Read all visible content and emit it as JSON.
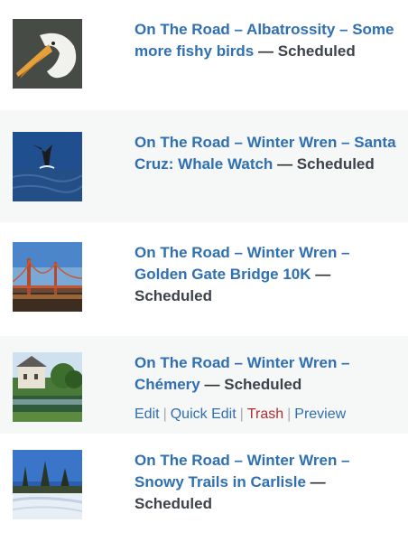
{
  "posts": [
    {
      "title": "On The Road – Albatrossity – Some more fishy birds",
      "separator": "—",
      "state": "Scheduled",
      "thumb_icon": "pelican-photo"
    },
    {
      "title": "On The Road – Winter Wren – Santa Cruz: Whale Watch",
      "separator": "—",
      "state": "Scheduled",
      "thumb_icon": "whale-tail-photo"
    },
    {
      "title": "On The Road – Winter Wren – Golden Gate Bridge 10K",
      "separator": "—",
      "state": "Scheduled",
      "thumb_icon": "golden-gate-bridge-photo"
    },
    {
      "title": "On The Road – Winter Wren – Chémery",
      "separator": "—",
      "state": "Scheduled",
      "thumb_icon": "chateau-pond-photo",
      "actions": {
        "edit": "Edit",
        "quick_edit": "Quick Edit",
        "trash": "Trash",
        "preview": "Preview",
        "divider": "|"
      }
    },
    {
      "title": "On The Road – Winter Wren – Snowy Trails in Carlisle",
      "separator": "—",
      "state": "Scheduled",
      "thumb_icon": "snowy-trail-photo"
    }
  ],
  "colors": {
    "link": "#2f6fb3",
    "trash": "#b32d2e",
    "alt_row": "#f6f7f7"
  }
}
